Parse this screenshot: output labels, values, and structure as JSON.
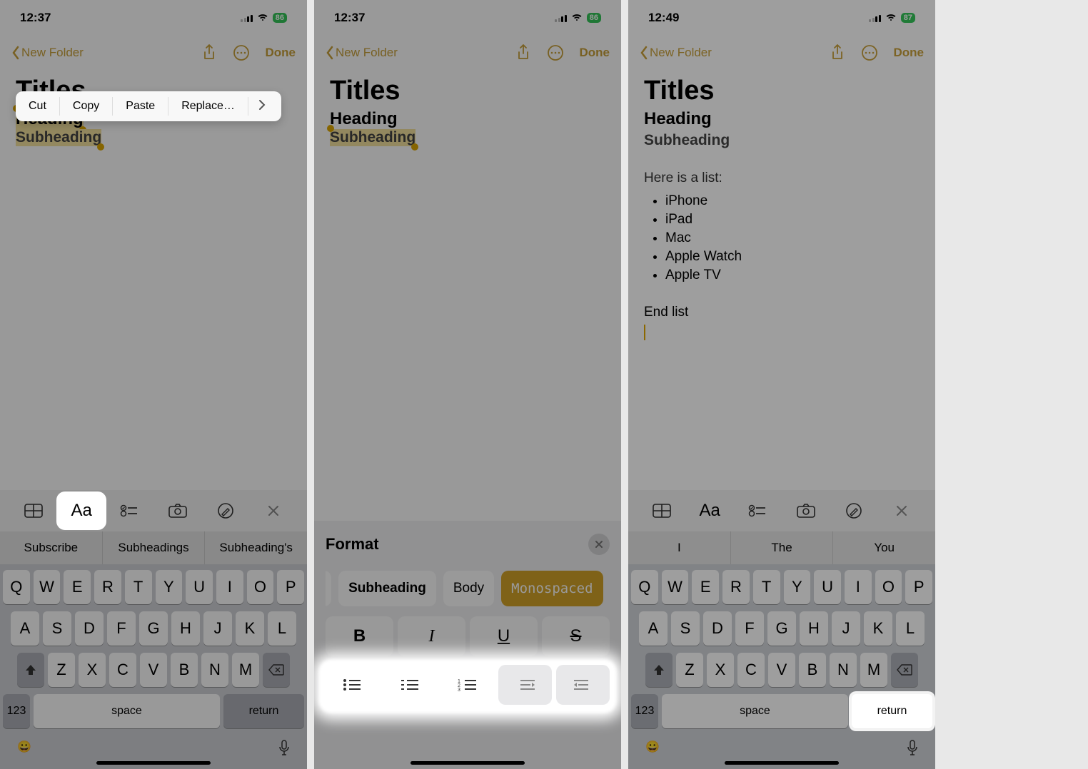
{
  "frames": [
    {
      "status": {
        "time": "12:37",
        "battery": "86"
      },
      "nav": {
        "back": "New Folder",
        "done": "Done"
      },
      "note": {
        "title": "Titles",
        "heading": "Heading",
        "subheading": "Subheading"
      },
      "contextMenu": [
        "Cut",
        "Copy",
        "Paste",
        "Replace…"
      ],
      "toolbarIcons": [
        "table-icon",
        "text-format-icon",
        "checklist-icon",
        "camera-icon",
        "markup-icon",
        "close-icon"
      ],
      "toolbarHighlight": 1,
      "suggestions": [
        "Subscribe",
        "Subheadings",
        "Subheading's"
      ],
      "keyboard": {
        "row1": [
          "Q",
          "W",
          "E",
          "R",
          "T",
          "Y",
          "U",
          "I",
          "O",
          "P"
        ],
        "row2": [
          "A",
          "S",
          "D",
          "F",
          "G",
          "H",
          "J",
          "K",
          "L"
        ],
        "row3": [
          "Z",
          "X",
          "C",
          "V",
          "B",
          "N",
          "M"
        ],
        "bottom": {
          "num": "123",
          "space": "space",
          "return": "return"
        }
      }
    },
    {
      "status": {
        "time": "12:37",
        "battery": "86"
      },
      "nav": {
        "back": "New Folder",
        "done": "Done"
      },
      "note": {
        "title": "Titles",
        "heading": "Heading",
        "subheading": "Subheading"
      },
      "format": {
        "title": "Format",
        "styles": [
          {
            "label": "ding",
            "partial": true
          },
          {
            "label": "Subheading",
            "bold": true
          },
          {
            "label": "Body"
          },
          {
            "label": "Monospaced",
            "selected": true
          }
        ],
        "styleButtons": [
          "B",
          "I",
          "U",
          "S"
        ],
        "listButtons": [
          "bullet-list-icon",
          "dash-list-icon",
          "numbered-list-icon",
          "outdent-icon",
          "indent-icon"
        ]
      }
    },
    {
      "status": {
        "time": "12:49",
        "battery": "87"
      },
      "nav": {
        "back": "New Folder",
        "done": "Done"
      },
      "note": {
        "title": "Titles",
        "heading": "Heading",
        "subheading": "Subheading",
        "preList": "Here is a list:",
        "listItems": [
          "iPhone",
          "iPad",
          "Mac",
          "Apple Watch",
          "Apple TV"
        ],
        "postList": "End list"
      },
      "toolbarIcons": [
        "table-icon",
        "text-format-icon",
        "checklist-icon",
        "camera-icon",
        "markup-icon",
        "close-icon"
      ],
      "suggestions": [
        "I",
        "The",
        "You"
      ],
      "keyboard": {
        "row1": [
          "Q",
          "W",
          "E",
          "R",
          "T",
          "Y",
          "U",
          "I",
          "O",
          "P"
        ],
        "row2": [
          "A",
          "S",
          "D",
          "F",
          "G",
          "H",
          "J",
          "K",
          "L"
        ],
        "row3": [
          "Z",
          "X",
          "C",
          "V",
          "B",
          "N",
          "M"
        ],
        "bottom": {
          "num": "123",
          "space": "space",
          "return": "return"
        }
      },
      "returnHighlight": true
    }
  ]
}
